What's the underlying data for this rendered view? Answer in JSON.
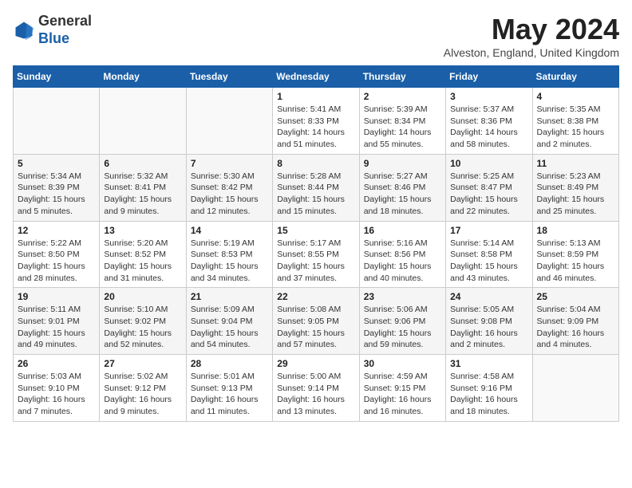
{
  "header": {
    "logo_general": "General",
    "logo_blue": "Blue",
    "month_title": "May 2024",
    "location": "Alveston, England, United Kingdom"
  },
  "days_of_week": [
    "Sunday",
    "Monday",
    "Tuesday",
    "Wednesday",
    "Thursday",
    "Friday",
    "Saturday"
  ],
  "weeks": [
    [
      {
        "day": "",
        "info": ""
      },
      {
        "day": "",
        "info": ""
      },
      {
        "day": "",
        "info": ""
      },
      {
        "day": "1",
        "info": "Sunrise: 5:41 AM\nSunset: 8:33 PM\nDaylight: 14 hours\nand 51 minutes."
      },
      {
        "day": "2",
        "info": "Sunrise: 5:39 AM\nSunset: 8:34 PM\nDaylight: 14 hours\nand 55 minutes."
      },
      {
        "day": "3",
        "info": "Sunrise: 5:37 AM\nSunset: 8:36 PM\nDaylight: 14 hours\nand 58 minutes."
      },
      {
        "day": "4",
        "info": "Sunrise: 5:35 AM\nSunset: 8:38 PM\nDaylight: 15 hours\nand 2 minutes."
      }
    ],
    [
      {
        "day": "5",
        "info": "Sunrise: 5:34 AM\nSunset: 8:39 PM\nDaylight: 15 hours\nand 5 minutes."
      },
      {
        "day": "6",
        "info": "Sunrise: 5:32 AM\nSunset: 8:41 PM\nDaylight: 15 hours\nand 9 minutes."
      },
      {
        "day": "7",
        "info": "Sunrise: 5:30 AM\nSunset: 8:42 PM\nDaylight: 15 hours\nand 12 minutes."
      },
      {
        "day": "8",
        "info": "Sunrise: 5:28 AM\nSunset: 8:44 PM\nDaylight: 15 hours\nand 15 minutes."
      },
      {
        "day": "9",
        "info": "Sunrise: 5:27 AM\nSunset: 8:46 PM\nDaylight: 15 hours\nand 18 minutes."
      },
      {
        "day": "10",
        "info": "Sunrise: 5:25 AM\nSunset: 8:47 PM\nDaylight: 15 hours\nand 22 minutes."
      },
      {
        "day": "11",
        "info": "Sunrise: 5:23 AM\nSunset: 8:49 PM\nDaylight: 15 hours\nand 25 minutes."
      }
    ],
    [
      {
        "day": "12",
        "info": "Sunrise: 5:22 AM\nSunset: 8:50 PM\nDaylight: 15 hours\nand 28 minutes."
      },
      {
        "day": "13",
        "info": "Sunrise: 5:20 AM\nSunset: 8:52 PM\nDaylight: 15 hours\nand 31 minutes."
      },
      {
        "day": "14",
        "info": "Sunrise: 5:19 AM\nSunset: 8:53 PM\nDaylight: 15 hours\nand 34 minutes."
      },
      {
        "day": "15",
        "info": "Sunrise: 5:17 AM\nSunset: 8:55 PM\nDaylight: 15 hours\nand 37 minutes."
      },
      {
        "day": "16",
        "info": "Sunrise: 5:16 AM\nSunset: 8:56 PM\nDaylight: 15 hours\nand 40 minutes."
      },
      {
        "day": "17",
        "info": "Sunrise: 5:14 AM\nSunset: 8:58 PM\nDaylight: 15 hours\nand 43 minutes."
      },
      {
        "day": "18",
        "info": "Sunrise: 5:13 AM\nSunset: 8:59 PM\nDaylight: 15 hours\nand 46 minutes."
      }
    ],
    [
      {
        "day": "19",
        "info": "Sunrise: 5:11 AM\nSunset: 9:01 PM\nDaylight: 15 hours\nand 49 minutes."
      },
      {
        "day": "20",
        "info": "Sunrise: 5:10 AM\nSunset: 9:02 PM\nDaylight: 15 hours\nand 52 minutes."
      },
      {
        "day": "21",
        "info": "Sunrise: 5:09 AM\nSunset: 9:04 PM\nDaylight: 15 hours\nand 54 minutes."
      },
      {
        "day": "22",
        "info": "Sunrise: 5:08 AM\nSunset: 9:05 PM\nDaylight: 15 hours\nand 57 minutes."
      },
      {
        "day": "23",
        "info": "Sunrise: 5:06 AM\nSunset: 9:06 PM\nDaylight: 15 hours\nand 59 minutes."
      },
      {
        "day": "24",
        "info": "Sunrise: 5:05 AM\nSunset: 9:08 PM\nDaylight: 16 hours\nand 2 minutes."
      },
      {
        "day": "25",
        "info": "Sunrise: 5:04 AM\nSunset: 9:09 PM\nDaylight: 16 hours\nand 4 minutes."
      }
    ],
    [
      {
        "day": "26",
        "info": "Sunrise: 5:03 AM\nSunset: 9:10 PM\nDaylight: 16 hours\nand 7 minutes."
      },
      {
        "day": "27",
        "info": "Sunrise: 5:02 AM\nSunset: 9:12 PM\nDaylight: 16 hours\nand 9 minutes."
      },
      {
        "day": "28",
        "info": "Sunrise: 5:01 AM\nSunset: 9:13 PM\nDaylight: 16 hours\nand 11 minutes."
      },
      {
        "day": "29",
        "info": "Sunrise: 5:00 AM\nSunset: 9:14 PM\nDaylight: 16 hours\nand 13 minutes."
      },
      {
        "day": "30",
        "info": "Sunrise: 4:59 AM\nSunset: 9:15 PM\nDaylight: 16 hours\nand 16 minutes."
      },
      {
        "day": "31",
        "info": "Sunrise: 4:58 AM\nSunset: 9:16 PM\nDaylight: 16 hours\nand 18 minutes."
      },
      {
        "day": "",
        "info": ""
      }
    ]
  ]
}
